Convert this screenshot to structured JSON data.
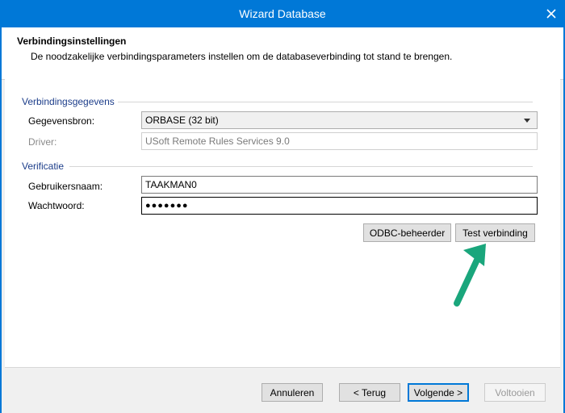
{
  "window": {
    "title": "Wizard Database",
    "close_icon": "close-icon"
  },
  "header": {
    "title": "Verbindingsinstellingen",
    "subtitle": "De noodzakelijke verbindingsparameters instellen om de databaseverbinding tot stand te brengen."
  },
  "connection": {
    "group_title": "Verbindingsgegevens",
    "datasource_label": "Gegevensbron:",
    "datasource_value": "ORBASE (32 bit)",
    "driver_label": "Driver:",
    "driver_value": "USoft Remote Rules Services 9.0"
  },
  "verification": {
    "group_title": "Verificatie",
    "username_label": "Gebruikersnaam:",
    "username_value": "TAAKMAN0",
    "password_label": "Wachtwoord:",
    "password_value": "●●●●●●●"
  },
  "actions": {
    "odbc_label": "ODBC-beheerder",
    "test_label": "Test verbinding"
  },
  "footer": {
    "cancel_label": "Annuleren",
    "back_label": "< Terug",
    "next_label": "Volgende >",
    "finish_label": "Voltooien"
  },
  "colors": {
    "titlebar": "#0078d7",
    "group_title": "#1c3d8a",
    "annotation_arrow": "#1aa67c"
  }
}
